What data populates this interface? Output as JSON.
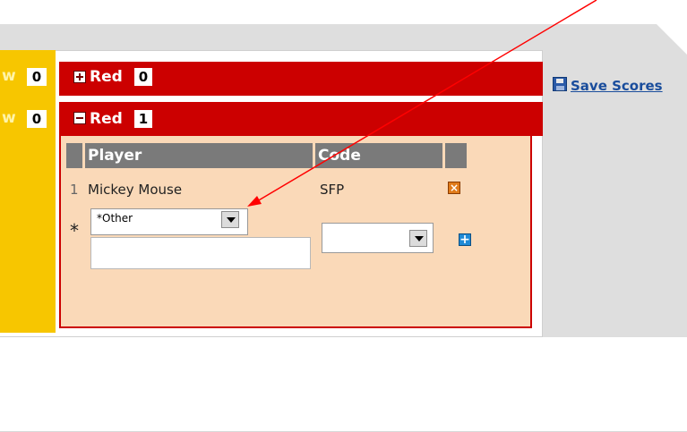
{
  "left_stubs": [
    {
      "letter": "w",
      "value": "0"
    },
    {
      "letter": "w",
      "value": "0"
    }
  ],
  "teams": [
    {
      "name": "Red",
      "count": "0",
      "state": "collapsed",
      "toggle_icon": "plus-box-icon"
    },
    {
      "name": "Red",
      "count": "1",
      "state": "expanded",
      "toggle_icon": "minus-box-icon"
    }
  ],
  "table": {
    "headers": [
      "Player",
      "Code"
    ],
    "rows": [
      {
        "index": "1",
        "player": "Mickey Mouse",
        "code": "SFP"
      }
    ]
  },
  "new_entry": {
    "marker": "*",
    "player_select": "*Other",
    "player_text": "",
    "code_select": ""
  },
  "sidebar": {
    "save_label": "Save Scores",
    "save_icon": "floppy-disk-icon"
  },
  "annotation": {
    "arrow_color": "#ff0000"
  },
  "colors": {
    "team_red": "#cc0000",
    "body_peach": "#fad9b8",
    "column_yellow": "#f7c600",
    "header_gray": "#7a7a7a"
  }
}
